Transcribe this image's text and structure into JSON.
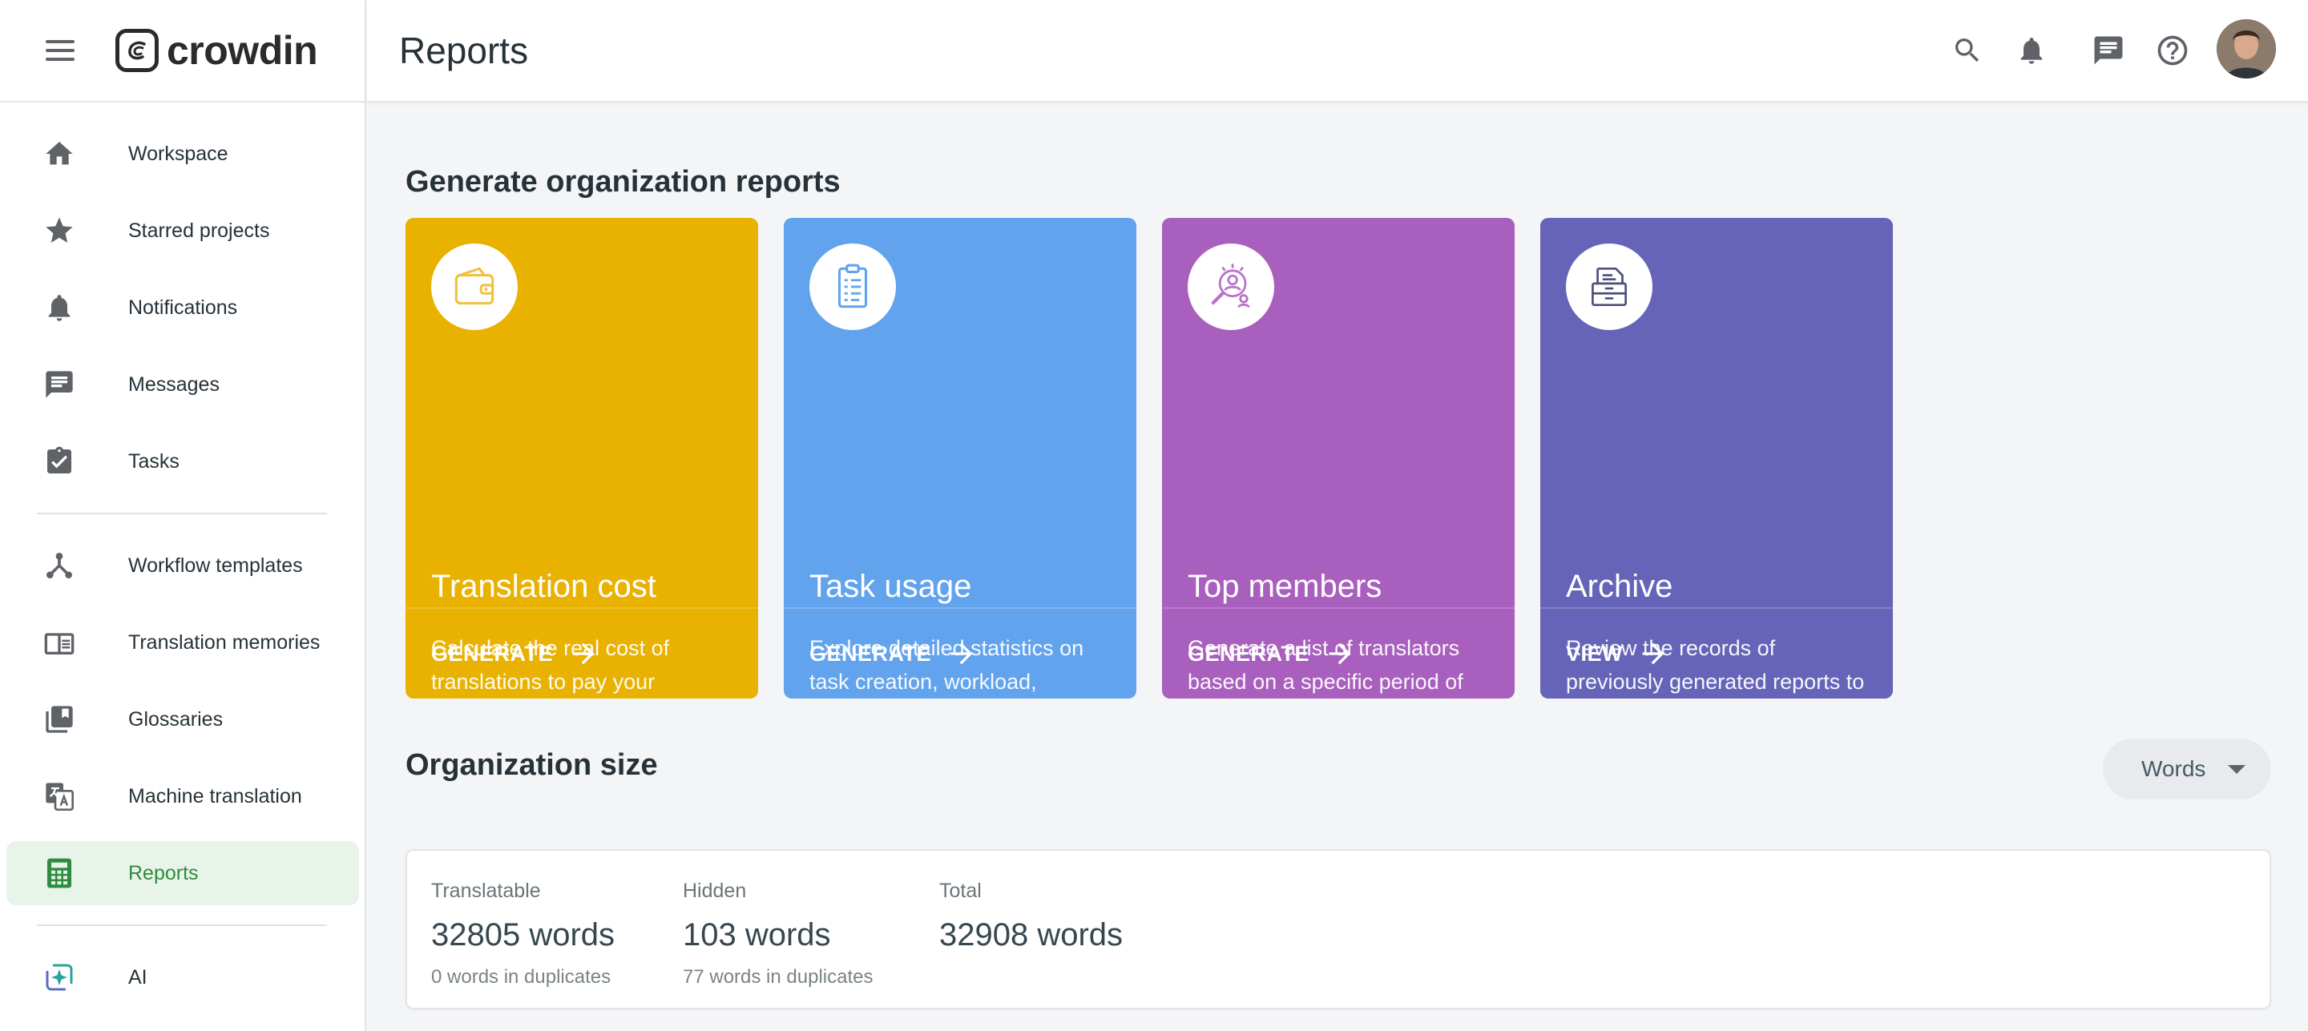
{
  "brand": {
    "name": "crowdin"
  },
  "header": {
    "title": "Reports"
  },
  "sidebar": {
    "items": [
      {
        "label": "Workspace",
        "icon": "home-icon"
      },
      {
        "label": "Starred projects",
        "icon": "star-icon"
      },
      {
        "label": "Notifications",
        "icon": "bell-icon"
      },
      {
        "label": "Messages",
        "icon": "message-icon"
      },
      {
        "label": "Tasks",
        "icon": "clipboard-check-icon"
      },
      {
        "label": "Workflow templates",
        "icon": "workflow-icon"
      },
      {
        "label": "Translation memories",
        "icon": "book-icon"
      },
      {
        "label": "Glossaries",
        "icon": "library-icon"
      },
      {
        "label": "Machine translation",
        "icon": "translate-icon"
      },
      {
        "label": "Reports",
        "icon": "calculator-icon",
        "active": true
      },
      {
        "label": "AI",
        "icon": "ai-sparkle-icon"
      }
    ]
  },
  "generate_section": {
    "title": "Generate organization reports"
  },
  "cards": [
    {
      "title": "Translation cost",
      "description": "Calculate the real cost of translations to pay your translators and proofreaders",
      "action": "GENERATE",
      "color": "#e9b200",
      "icon": "wallet-icon"
    },
    {
      "title": "Task usage",
      "description": "Explore detailed statistics on task creation, workload, progress, and performance.",
      "action": "GENERATE",
      "color": "#62a3ee",
      "icon": "clipboard-list-icon"
    },
    {
      "title": "Top members",
      "description": "Generate a list of translators based on a specific period of time to see who contributed the most to your project's translation.",
      "action": "GENERATE",
      "color": "#a95fbd",
      "icon": "members-search-icon"
    },
    {
      "title": "Archive",
      "description": "Review the records of previously generated reports to analyze historical data for insights and track project progress.",
      "action": "VIEW",
      "color": "#6664b9",
      "icon": "archive-icon"
    }
  ],
  "org_size": {
    "title": "Organization size",
    "unit_select": "Words",
    "stats": [
      {
        "label": "Translatable",
        "value": "32805 words",
        "sub": "0 words in duplicates"
      },
      {
        "label": "Hidden",
        "value": "103 words",
        "sub": "77 words in duplicates"
      },
      {
        "label": "Total",
        "value": "32908 words",
        "sub": ""
      }
    ]
  }
}
